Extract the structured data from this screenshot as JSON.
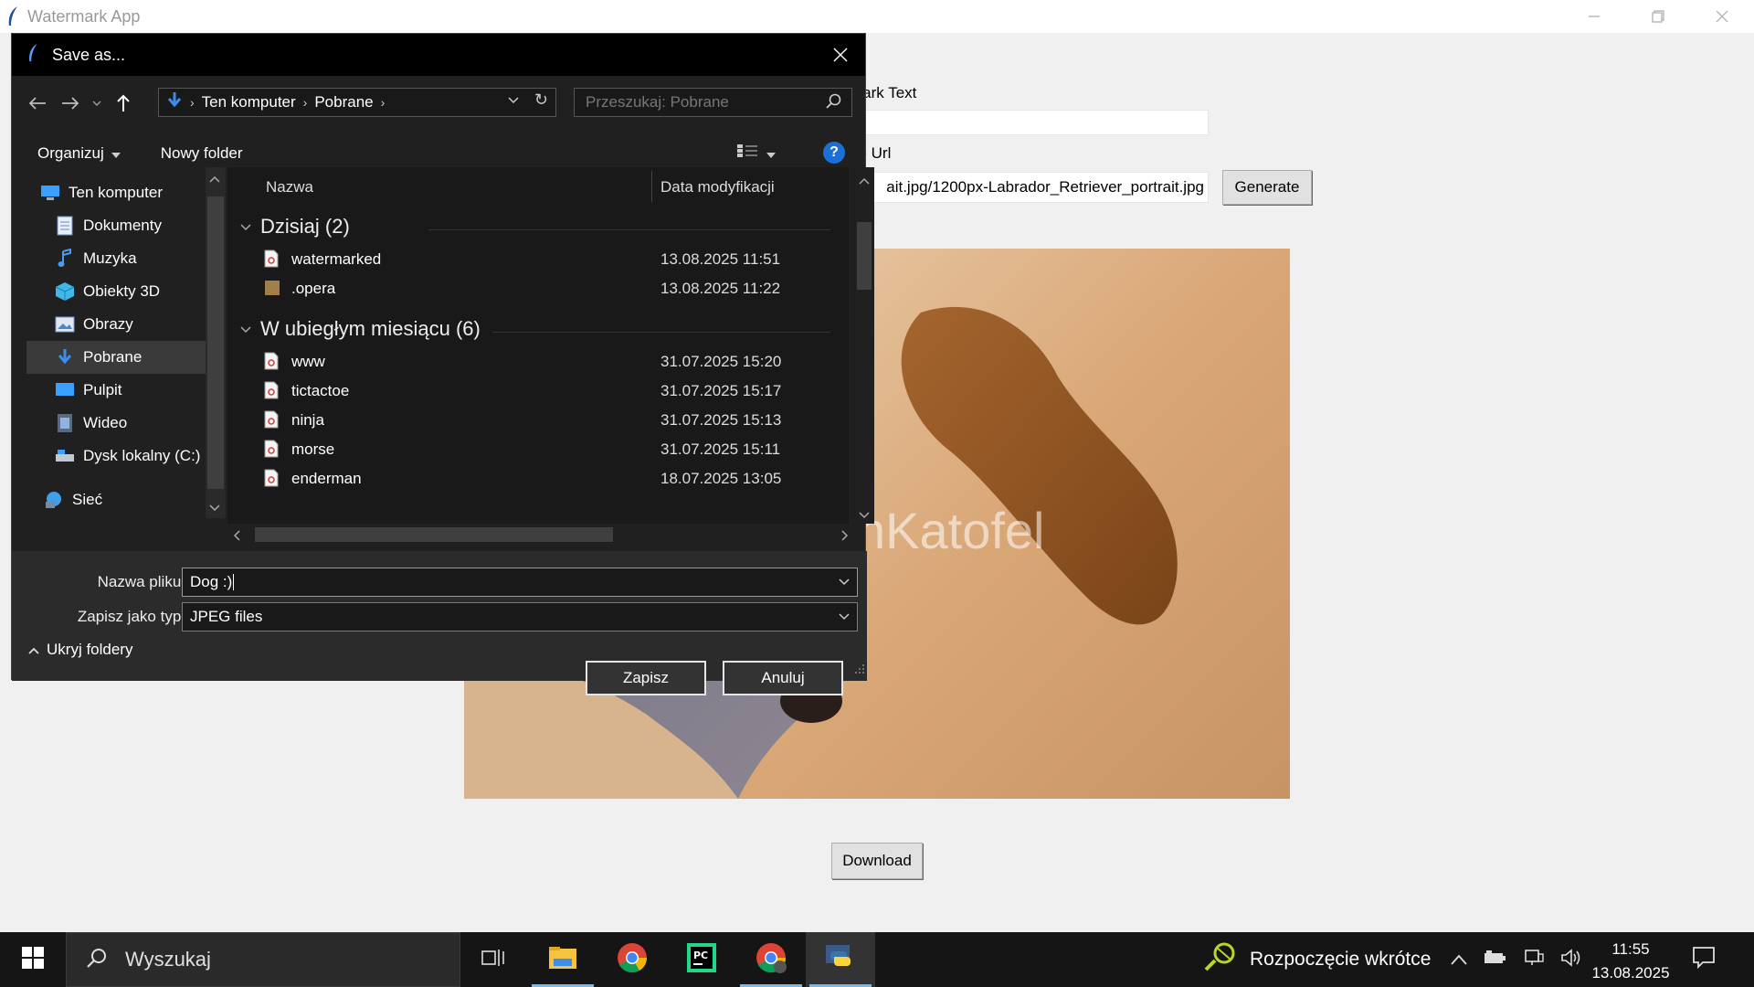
{
  "app": {
    "title": "Watermark App",
    "window_controls": [
      "minimize",
      "restore",
      "close"
    ]
  },
  "form": {
    "watermark_label": "mark Text",
    "watermark_value": "",
    "url_label": "ge Url",
    "url_value": "ait.jpg/1200px-Labrador_Retriever_portrait.jpg",
    "generate_label": "Generate",
    "download_label": "Download"
  },
  "preview": {
    "watermark_text": "nKatofel"
  },
  "dialog": {
    "title": "Save as...",
    "breadcrumb": [
      "Ten komputer",
      "Pobrane"
    ],
    "search_placeholder": "Przeszukaj: Pobrane",
    "organize_label": "Organizuj",
    "new_folder_label": "Nowy folder",
    "help_label": "?",
    "nav_items": [
      {
        "label": "Ten komputer",
        "icon": "computer-icon"
      },
      {
        "label": "Dokumenty",
        "icon": "documents-icon"
      },
      {
        "label": "Muzyka",
        "icon": "music-icon"
      },
      {
        "label": "Obiekty 3D",
        "icon": "cube-icon"
      },
      {
        "label": "Obrazy",
        "icon": "pictures-icon"
      },
      {
        "label": "Pobrane",
        "icon": "download-icon"
      },
      {
        "label": "Pulpit",
        "icon": "desktop-icon"
      },
      {
        "label": "Wideo",
        "icon": "video-icon"
      },
      {
        "label": "Dysk lokalny (C:)",
        "icon": "drive-icon"
      },
      {
        "label": "Sieć",
        "icon": "network-icon"
      }
    ],
    "columns": {
      "name": "Nazwa",
      "date": "Data modyfikacji"
    },
    "groups": [
      {
        "label": "Dzisiaj (2)",
        "files": [
          {
            "name": "watermarked",
            "date": "13.08.2025 11:51",
            "type": "file"
          },
          {
            "name": ".opera",
            "date": "13.08.2025 11:22",
            "type": "folder"
          }
        ]
      },
      {
        "label": "W ubiegłym miesiącu (6)",
        "files": [
          {
            "name": "www",
            "date": "31.07.2025 15:20",
            "type": "file"
          },
          {
            "name": "tictactoe",
            "date": "31.07.2025 15:17",
            "type": "file"
          },
          {
            "name": "ninja",
            "date": "31.07.2025 15:13",
            "type": "file"
          },
          {
            "name": "morse",
            "date": "31.07.2025 15:11",
            "type": "file"
          },
          {
            "name": "enderman",
            "date": "18.07.2025 13:05",
            "type": "file"
          }
        ]
      }
    ],
    "filename_label": "Nazwa pliku:",
    "filename_value": "Dog :)",
    "filetype_label": "Zapisz jako typ:",
    "filetype_value": "JPEG files",
    "save_label": "Zapisz",
    "cancel_label": "Anuluj",
    "hide_folders_label": "Ukryj foldery"
  },
  "taskbar": {
    "search_placeholder": "Wyszukaj",
    "weather_text": "Rozpoczęcie wkrótce",
    "time": "11:55",
    "date": "13.08.2025"
  }
}
